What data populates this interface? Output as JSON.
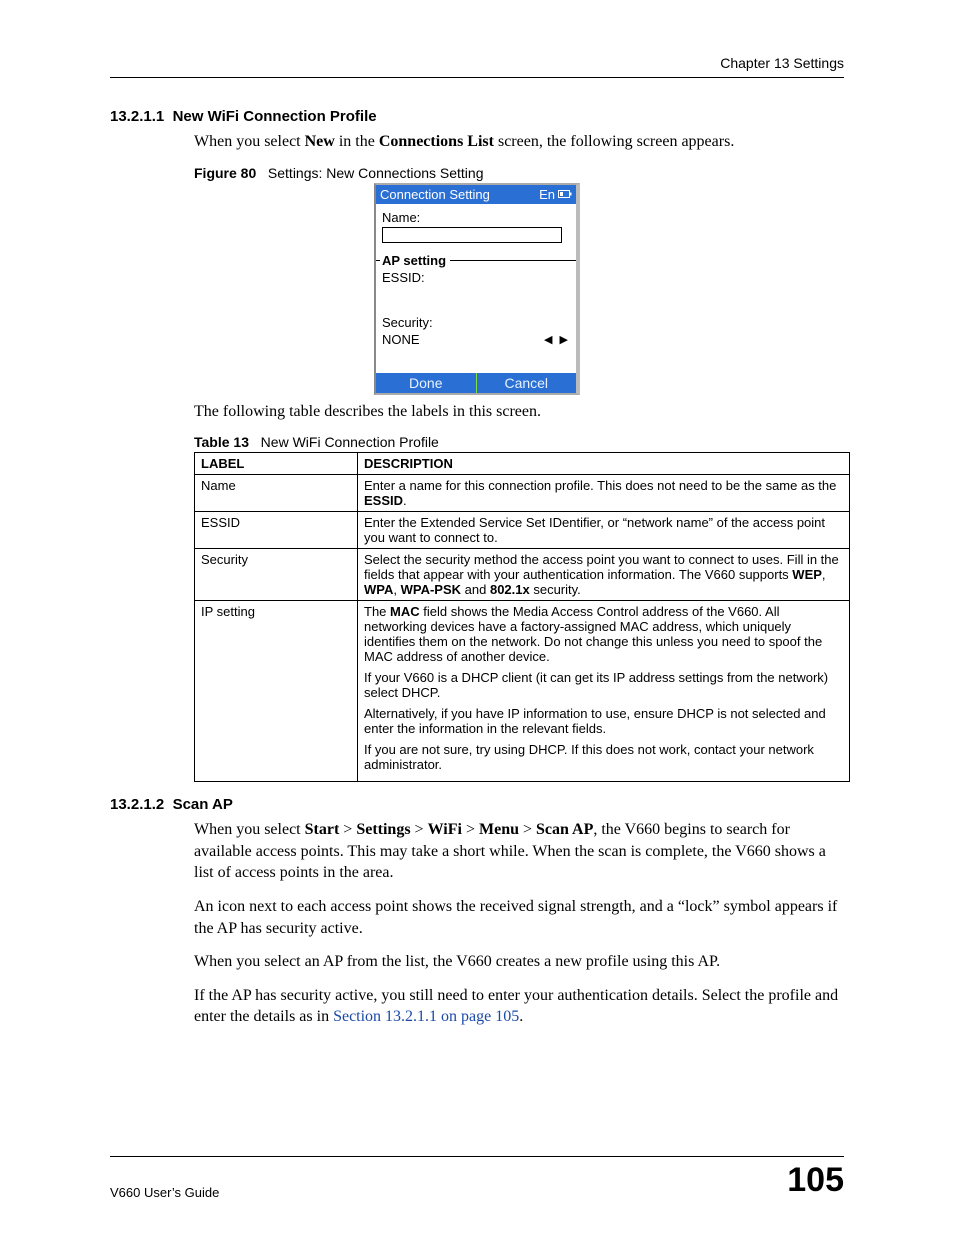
{
  "header": {
    "chapter": "Chapter 13 Settings"
  },
  "section1": {
    "number": "13.2.1.1",
    "title": "New WiFi Connection Profile",
    "intro_prefix": "When you select ",
    "intro_new": "New",
    "intro_mid": " in the ",
    "intro_conn_list": "Connections List",
    "intro_suffix": " screen, the following screen appears."
  },
  "figure": {
    "label": "Figure 80",
    "caption": "Settings: New Connections Setting",
    "titlebar": "Connection Setting",
    "status_lang": "En",
    "name_label": "Name:",
    "ap_setting": "AP setting",
    "essid_label": "ESSID:",
    "security_label": "Security:",
    "security_value": "NONE",
    "btn_done": "Done",
    "btn_cancel": "Cancel"
  },
  "table_intro": "The following table describes the labels in this screen.",
  "table": {
    "label": "Table 13",
    "caption": "New WiFi Connection Profile",
    "headers": {
      "label": "LABEL",
      "description": "DESCRIPTION"
    },
    "rows": [
      {
        "label": "Name",
        "desc_parts": {
          "p1a": "Enter a name for this connection profile. This does not need to be the same as the ",
          "p1b": "ESSID",
          "p1c": "."
        }
      },
      {
        "label": "ESSID",
        "desc": "Enter the Extended Service Set IDentifier, or “network name” of the access point you want to connect to."
      },
      {
        "label": "Security",
        "desc_parts": {
          "a": "Select the security method the access point you want to connect to uses. Fill in the fields that appear with your authentication information. The V660 supports ",
          "b1": "WEP",
          "c1": ", ",
          "b2": "WPA",
          "c2": ", ",
          "b3": "WPA-PSK",
          "c3": " and ",
          "b4": "802.1x",
          "c4": " security."
        }
      },
      {
        "label": "IP setting",
        "p1_parts": {
          "a": "The ",
          "b": "MAC",
          "c": " field shows the Media Access Control address of the V660. All networking devices have a factory-assigned MAC address, which uniquely identifies them on the network. Do not change this unless you need to spoof the MAC address of another device."
        },
        "p2": "If your V660 is a DHCP client (it can get its IP address settings from the network) select DHCP.",
        "p3": "Alternatively, if you have IP information to use, ensure DHCP is not selected and enter the information in the relevant fields.",
        "p4": "If you are not sure, try using DHCP. If this does not work, contact your network administrator."
      }
    ]
  },
  "section2": {
    "number": "13.2.1.2",
    "title": "Scan AP",
    "p1_parts": {
      "a": "When you select ",
      "b1": "Start",
      "s1": " > ",
      "b2": "Settings",
      "s2": " > ",
      "b3": "WiFi",
      "s3": " > ",
      "b4": "Menu",
      "s4": " > ",
      "b5": "Scan AP",
      "c": ", the V660 begins to search for available access points. This may take a short while. When the scan is complete, the V660 shows a list of access points in the area."
    },
    "p2": "An icon next to each access point shows the received signal strength, and a “lock” symbol appears if the AP has security active.",
    "p3": "When you select an AP from the list, the V660 creates a new profile using this AP.",
    "p4_a": "If the AP has security active, you still need to enter your authentication details. Select the profile and enter the details as in ",
    "p4_link": "Section 13.2.1.1 on page 105",
    "p4_c": "."
  },
  "footer": {
    "guide": "V660 User’s Guide",
    "page": "105"
  }
}
